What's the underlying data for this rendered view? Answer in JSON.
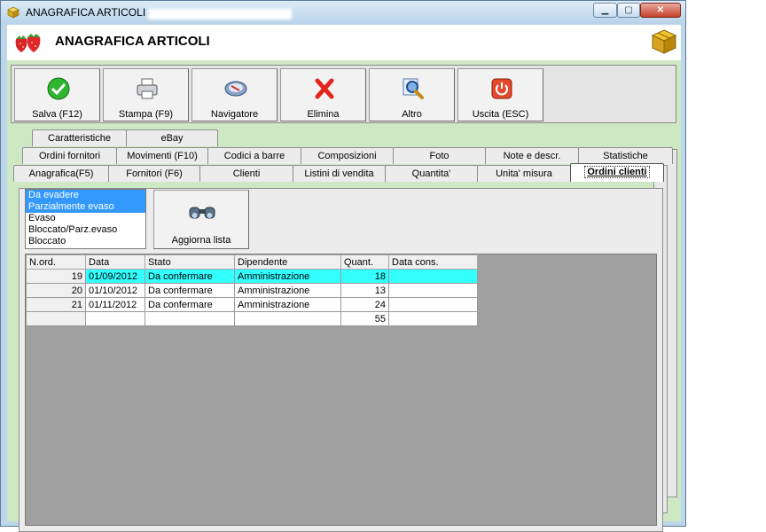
{
  "window": {
    "title": "ANAGRAFICA ARTICOLI -",
    "minimize_label": "▁",
    "maximize_label": "▢",
    "close_label": "✕"
  },
  "header": {
    "title": "ANAGRAFICA ARTICOLI"
  },
  "toolbar": {
    "buttons": [
      {
        "label": "Salva (F12)",
        "icon": "check-icon"
      },
      {
        "label": "Stampa (F9)",
        "icon": "printer-icon"
      },
      {
        "label": "Navigatore",
        "icon": "navigator-icon"
      },
      {
        "label": "Elimina",
        "icon": "delete-x-icon"
      },
      {
        "label": "Altro",
        "icon": "search-icon"
      },
      {
        "label": "Uscita (ESC)",
        "icon": "power-icon"
      }
    ]
  },
  "tabs": {
    "row1": [
      "Caratteristiche",
      "eBay"
    ],
    "row2": [
      "Ordini fornitori",
      "Movimenti (F10)",
      "Codici a barre",
      "Composizioni",
      "Foto",
      "Note e descr.",
      "Statistiche"
    ],
    "row3": [
      "Anagrafica(F5)",
      "Fornitori (F6)",
      "Clienti",
      "Listini di vendita",
      "Quantita'",
      "Unita' misura",
      "Ordini clienti"
    ],
    "active": "Ordini clienti"
  },
  "filter": {
    "options": [
      {
        "label": "Da evadere",
        "selected": true
      },
      {
        "label": "Parzialmente evaso",
        "selected": true
      },
      {
        "label": "Evaso",
        "selected": false
      },
      {
        "label": "Bloccato/Parz.evaso",
        "selected": false
      },
      {
        "label": "Bloccato",
        "selected": false
      }
    ],
    "refresh_label": "Aggiorna lista"
  },
  "grid": {
    "columns": [
      "N.ord.",
      "Data",
      "Stato",
      "Dipendente",
      "Quant.",
      "Data cons."
    ],
    "rows": [
      {
        "n_ord": "19",
        "data": "01/09/2012",
        "stato": "Da confermare",
        "dipendente": "Amministrazione",
        "quant": "18",
        "data_cons": "",
        "highlighted": true
      },
      {
        "n_ord": "20",
        "data": "01/10/2012",
        "stato": "Da confermare",
        "dipendente": "Amministrazione",
        "quant": "13",
        "data_cons": "",
        "highlighted": false
      },
      {
        "n_ord": "21",
        "data": "01/11/2012",
        "stato": "Da confermare",
        "dipendente": "Amministrazione",
        "quant": "24",
        "data_cons": "",
        "highlighted": false
      }
    ],
    "total": {
      "quant": "55"
    }
  },
  "colors": {
    "client_bg": "#cfe8c4",
    "row_highlight": "#33ffff",
    "list_selection": "#3399ff",
    "grid_empty": "#a0a0a0"
  }
}
